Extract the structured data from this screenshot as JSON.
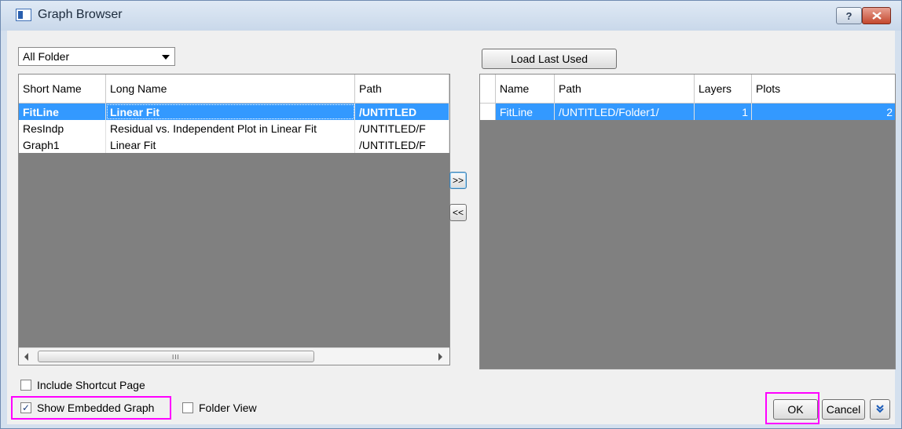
{
  "window": {
    "title": "Graph Browser",
    "help_label": "?",
    "close_label": "x"
  },
  "folder_select": {
    "value": "All Folder"
  },
  "load_button": "Load Last Used",
  "left_table": {
    "headers": [
      "Short Name",
      "Long Name",
      "Path"
    ],
    "rows": [
      {
        "short": "FitLine",
        "long": "Linear Fit",
        "path": "/UNTITLED",
        "selected": true
      },
      {
        "short": "ResIndp",
        "long": "Residual vs. Independent Plot in Linear Fit",
        "path": "/UNTITLED/F",
        "selected": false
      },
      {
        "short": "Graph1",
        "long": "Linear Fit",
        "path": "/UNTITLED/F",
        "selected": false
      }
    ],
    "scroll_grip": "III"
  },
  "move_buttons": {
    "add": ">>",
    "remove": "<<"
  },
  "right_table": {
    "headers": [
      "Name",
      "Path",
      "Layers",
      "Plots"
    ],
    "rows": [
      {
        "name": "FitLine",
        "path": "/UNTITLED/Folder1/",
        "layers": "1",
        "plots": "2",
        "selected": true
      }
    ]
  },
  "options": {
    "include_shortcut": {
      "label": "Include Shortcut Page",
      "checked": false
    },
    "show_embedded": {
      "label": "Show Embedded Graph",
      "checked": true
    },
    "folder_view": {
      "label": "Folder View",
      "checked": false
    }
  },
  "footer": {
    "ok_label": "OK",
    "cancel_label": "Cancel",
    "expand_label": "≫"
  },
  "colors": {
    "selection": "#3399ff",
    "highlight": "#ff00ff",
    "panel_gray": "#808080"
  }
}
